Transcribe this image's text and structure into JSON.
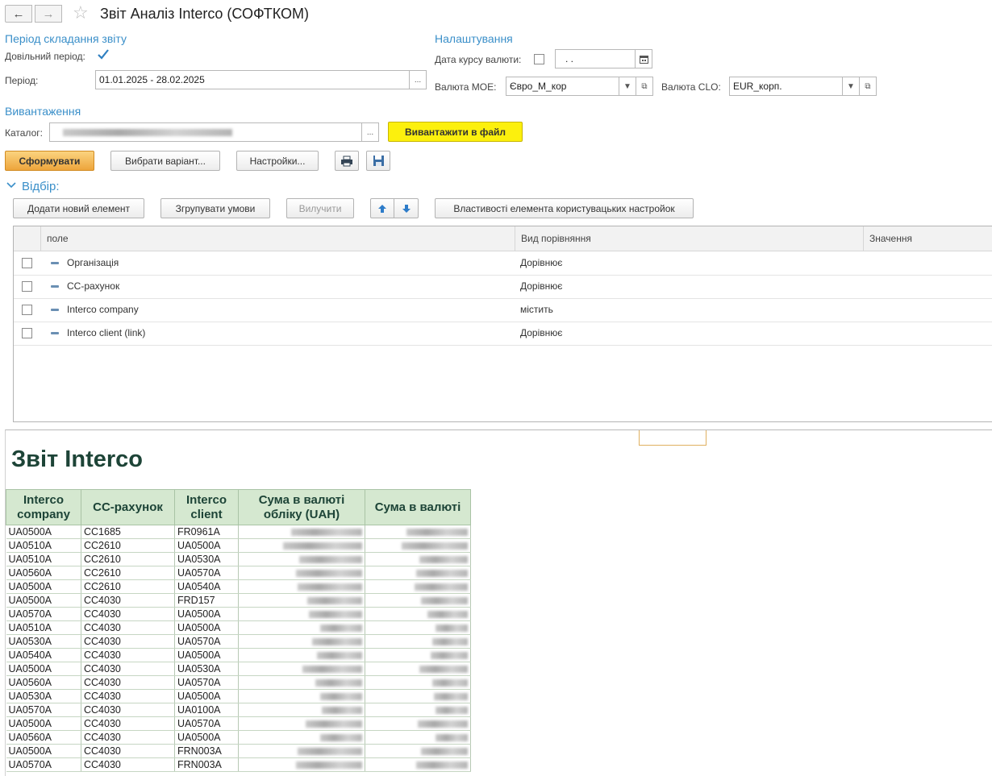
{
  "window": {
    "title": "Звіт Аналіз Interco (СОФТКОМ)",
    "back_icon": "←",
    "forward_icon": "→",
    "star_icon": "☆"
  },
  "period_section": {
    "heading": "Період складання звіту",
    "custom_period_label": "Довільний період:",
    "custom_period_checked": true,
    "period_label": "Період:",
    "period_value": "01.01.2025 - 28.02.2025"
  },
  "settings_section": {
    "heading": "Налаштування",
    "rate_date_label": "Дата курсу валюти:",
    "rate_date_value": " .  .",
    "moe_currency_label": "Валюта МОЕ:",
    "moe_currency_value": "Євро_М_кор",
    "clo_currency_label": "Валюта CLO:",
    "clo_currency_value": "EUR_корп."
  },
  "export_section": {
    "heading": "Вивантаження",
    "catalog_label": "Каталог:",
    "export_button": "Вивантажити в файл"
  },
  "toolbar": {
    "generate": "Сформувати",
    "choose_variant": "Вибрати варіант...",
    "settings": "Настройки...",
    "ellipsis": "..."
  },
  "filter": {
    "heading": "Відбір:",
    "add_element": "Додати новий елемент",
    "group_conditions": "Згрупувати умови",
    "ungroup": "Вилучити",
    "properties": "Властивості елемента користувацьких настройок",
    "columns": [
      "поле",
      "Вид порівняння",
      "Значення"
    ],
    "rows": [
      {
        "field": "Організація",
        "comparison": "Дорівнює"
      },
      {
        "field": "СС-рахунок",
        "comparison": "Дорівнює"
      },
      {
        "field": "Interco company",
        "comparison": "містить"
      },
      {
        "field": "Interco client (link)",
        "comparison": "Дорівнює"
      }
    ]
  },
  "report": {
    "title": "Звіт Interco",
    "headers": [
      "Interco company",
      "СС-рахунок",
      "Interco client",
      "Сума в валюті обліку (UAH)",
      "Сума в валюті"
    ],
    "rows": [
      [
        "UA0500A",
        "CC1685",
        "FR0961A"
      ],
      [
        "UA0510A",
        "CC2610",
        "UA0500A"
      ],
      [
        "UA0510A",
        "CC2610",
        "UA0530A"
      ],
      [
        "UA0560A",
        "CC2610",
        "UA0570A"
      ],
      [
        "UA0500A",
        "CC2610",
        "UA0540A"
      ],
      [
        "UA0500A",
        "CC4030",
        "FRD157"
      ],
      [
        "UA0570A",
        "CC4030",
        "UA0500A"
      ],
      [
        "UA0510A",
        "CC4030",
        "UA0500A"
      ],
      [
        "UA0530A",
        "CC4030",
        "UA0570A"
      ],
      [
        "UA0540A",
        "CC4030",
        "UA0500A"
      ],
      [
        "UA0500A",
        "CC4030",
        "UA0530A"
      ],
      [
        "UA0560A",
        "CC4030",
        "UA0570A"
      ],
      [
        "UA0530A",
        "CC4030",
        "UA0500A"
      ],
      [
        "UA0570A",
        "CC4030",
        "UA0100A"
      ],
      [
        "UA0500A",
        "CC4030",
        "UA0570A"
      ],
      [
        "UA0560A",
        "CC4030",
        "UA0500A"
      ],
      [
        "UA0500A",
        "CC4030",
        "FRN003A"
      ],
      [
        "UA0570A",
        "CC4030",
        "FRN003A"
      ]
    ]
  }
}
